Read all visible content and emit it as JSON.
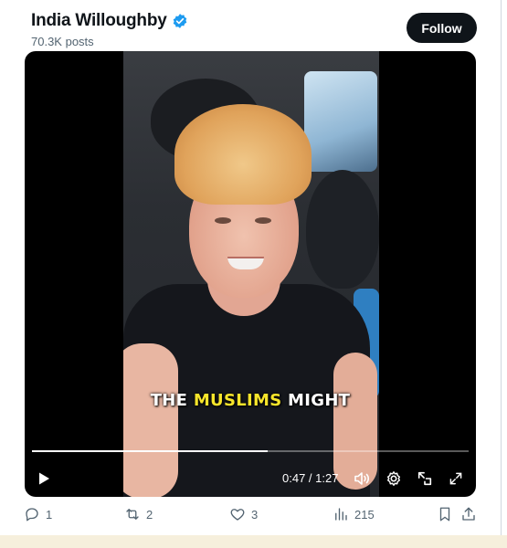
{
  "post": {
    "author_name": "India Willoughby",
    "author_posts": "70.3K posts",
    "follow_label": "Follow"
  },
  "video": {
    "caption_prefix": "THE ",
    "caption_highlight": "MUSLIMS",
    "caption_suffix": " MIGHT",
    "current_time": "0:47",
    "time_separator": " / ",
    "duration": "1:27",
    "progress": 0.54
  },
  "actions": {
    "replies": "1",
    "reposts": "2",
    "likes": "3",
    "views": "215"
  },
  "colors": {
    "verified": "#1d9bf0",
    "caption_highlight": "#f7e52b",
    "text_secondary": "#536471"
  },
  "icons": [
    "verified-badge-icon",
    "play-icon",
    "volume-icon",
    "settings-icon",
    "pip-icon",
    "fullscreen-icon",
    "reply-icon",
    "repost-icon",
    "like-icon",
    "views-icon",
    "bookmark-icon",
    "share-icon"
  ]
}
